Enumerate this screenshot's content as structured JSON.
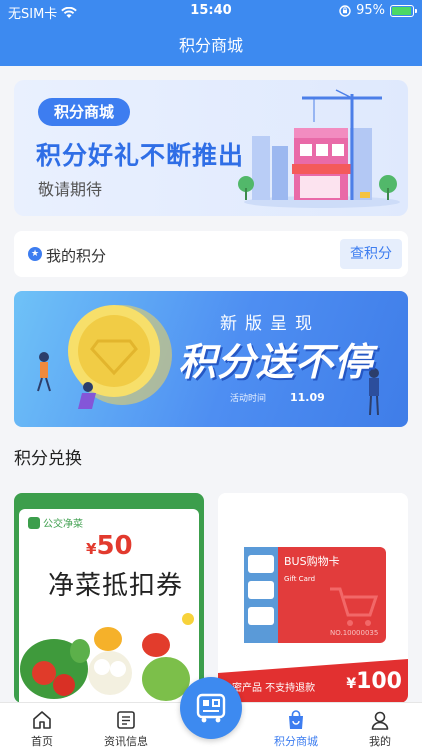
{
  "status_bar": {
    "carrier": "无SIM卡",
    "time": "15:40",
    "battery": "95%",
    "battery_level": 0.95
  },
  "nav": {
    "title": "积分商城"
  },
  "hero": {
    "badge": "积分商城",
    "headline": "积分好礼不断推出",
    "subline": "敬请期待"
  },
  "points": {
    "label": "我的积分",
    "button": "查积分"
  },
  "promo": {
    "subtitle": "新版呈现",
    "headline": "积分送不停",
    "date_label": "活动时间",
    "date": "11.09"
  },
  "exchange": {
    "title": "积分兑换"
  },
  "products": [
    {
      "tag": "公交净菜",
      "currency": "¥",
      "amount": "50",
      "name": "净菜抵扣券"
    },
    {
      "card_title": "BUS购物卡",
      "card_sub": "Gift Card",
      "card_no": "NO.10000035",
      "notice": "卡密产品 不支持退款",
      "currency": "¥",
      "amount": "100"
    }
  ],
  "tabbar": [
    {
      "label": "首页",
      "icon": "home-icon"
    },
    {
      "label": "资讯信息",
      "icon": "news-icon"
    },
    {
      "label": "",
      "icon": "bus-icon"
    },
    {
      "label": "积分商城",
      "icon": "shopping-bag-icon",
      "active": true
    },
    {
      "label": "我的",
      "icon": "user-icon"
    }
  ],
  "colors": {
    "accent": "#3d8af0",
    "price_red": "#e23a2e",
    "veg_green": "#3c9e4c"
  }
}
